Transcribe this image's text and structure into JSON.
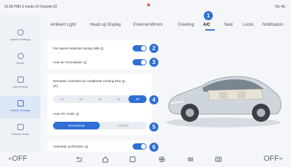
{
  "status_bar": {
    "left_text": "16:35 PM2.5 Inside:23 Outside:33",
    "right_text": "5G 4G"
  },
  "sidebar": {
    "items": [
      {
        "label": "System Settings",
        "icon": "gear-icon"
      },
      {
        "label": "ADAS",
        "icon": "steering-icon"
      },
      {
        "label": "New Energy",
        "icon": "battery-icon"
      },
      {
        "label": "Vehicle Settings",
        "icon": "car-icon"
      },
      {
        "label": "Vehicle Health",
        "icon": "car-health-icon"
      }
    ],
    "active_index": 3
  },
  "tabs": {
    "items": [
      "Ambient Light",
      "Head-up Display",
      "External Mirrors",
      "Greeting",
      "A/C",
      "Seat",
      "Locks",
      "Notification"
    ],
    "active": "A/C"
  },
  "badges": [
    "1",
    "2",
    "3",
    "4",
    "5",
    "6"
  ],
  "settings": {
    "fan_speed": {
      "label": "Fan speed reduction during calls",
      "enabled": true
    },
    "auto_recirc": {
      "label": "Auto air recirculation",
      "enabled": true
    },
    "remote_ac": {
      "label_line1": "Remotely controlled air conditioner running time",
      "label_line2": "(m)",
      "options": [
        "10",
        "15",
        "20",
        "25",
        "30"
      ],
      "selected": "30"
    },
    "auto_ac_mode": {
      "label": "Auto A/C mode",
      "options": [
        "Economical",
        "Comfort"
      ],
      "selected": "Economical"
    },
    "auto_purification": {
      "label": "Automatic purification",
      "enabled": true
    }
  },
  "bottom_bar": {
    "left_temp": "OFF",
    "right_temp": "OFF",
    "icons": [
      "back-icon",
      "home-icon",
      "square-icon",
      "fan-icon",
      "grid-icon",
      "seat-heat-icon"
    ]
  },
  "colors": {
    "accent": "#2f6fd6"
  }
}
